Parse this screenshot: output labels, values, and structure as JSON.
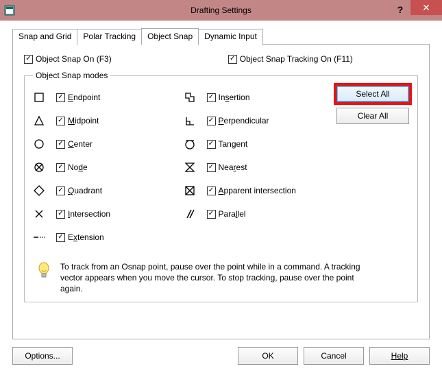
{
  "title": "Drafting Settings",
  "tabs": {
    "snap": "Snap and Grid",
    "polar": "Polar Tracking",
    "osnap": "Object Snap",
    "dyn": "Dynamic Input"
  },
  "top": {
    "osnap_on": "Object Snap On (F3)",
    "osnap_track_on": "Object Snap Tracking On (F11)"
  },
  "modes_legend": "Object Snap modes",
  "left": {
    "endpoint": "ndpoint",
    "endpoint_pre": "E",
    "midpoint": "idpoint",
    "midpoint_pre": "M",
    "center": "enter",
    "center_pre": "C",
    "node": "de",
    "node_pre": "No",
    "node_u": "d",
    "quadrant": "uadrant",
    "quadrant_pre": "Q",
    "intersection": "ntersection",
    "intersection_pre": "I",
    "extension": "tension",
    "extension_pre": "Ex",
    "extension_u": "x"
  },
  "right": {
    "insertion": "ertion",
    "insertion_pre": "In",
    "insertion_u": "s",
    "perpendicular": "erpendicular",
    "perpendicular_pre": "P",
    "tangent": "Tan",
    "tangent_u": "g",
    "tangent_post": "ent",
    "nearest": "Nea",
    "nearest_u": "r",
    "nearest_post": "est",
    "apparent": "pparent intersection",
    "apparent_pre": "A",
    "parallel": "Para",
    "parallel_u": "l",
    "parallel_post": "lel"
  },
  "buttons": {
    "select_all": "Select All",
    "clear_all": "Clear All",
    "options": "Options...",
    "ok": "OK",
    "cancel": "Cancel",
    "help": "Help"
  },
  "tip": "To track from an Osnap point, pause over the point while in a command.  A tracking vector appears when you move the cursor.  To stop tracking, pause over the point again.",
  "close_glyph": "✕",
  "help_glyph": "?"
}
